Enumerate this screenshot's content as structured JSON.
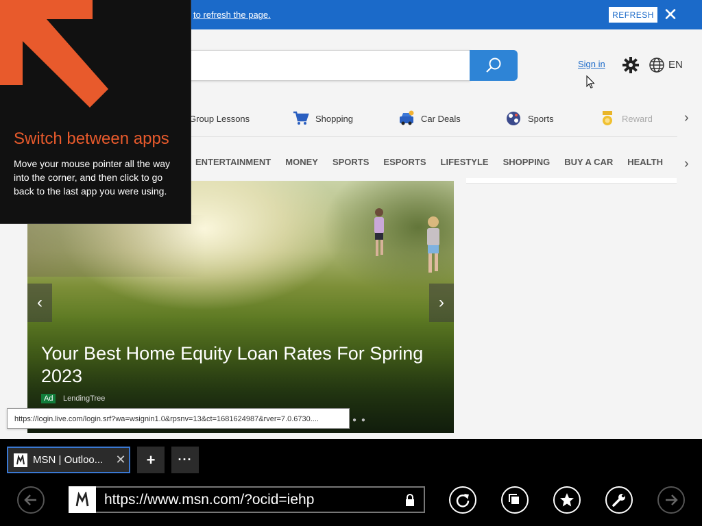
{
  "notification": {
    "text": "to refresh the page.",
    "refresh_label": "REFRESH",
    "close_glyph": "✕"
  },
  "header": {
    "search_placeholder": "",
    "signin_label": "Sign in",
    "language": "EN",
    "icons": [
      "search-icon",
      "gear-icon",
      "globe-icon"
    ]
  },
  "quick_links": [
    {
      "label": "Group Lessons",
      "icon": "none"
    },
    {
      "label": "Shopping",
      "icon": "cart-icon"
    },
    {
      "label": "Car Deals",
      "icon": "car-icon"
    },
    {
      "label": "Sports",
      "icon": "ball-icon"
    },
    {
      "label": "Reward",
      "icon": "medal-icon"
    }
  ],
  "nav_tabs": [
    "ENTERTAINMENT",
    "MONEY",
    "SPORTS",
    "ESPORTS",
    "LIFESTYLE",
    "SHOPPING",
    "BUY A CAR",
    "HEALTH"
  ],
  "hero": {
    "title": "Your Best Home Equity Loan Rates For Spring 2023",
    "ad_badge": "Ad",
    "source": "LendingTree",
    "dots": "● ●"
  },
  "status_url": "https://login.live.com/login.srf?wa=wsignin1.0&rpsnv=13&ct=1681624987&rver=7.0.6730....",
  "charm_tip": {
    "title": "Switch between apps",
    "body": "Move your mouse pointer all the way into the corner, and then click to go back to the last app you were using."
  },
  "browser": {
    "tab_title": "MSN | Outloo...",
    "tab_close": "✕",
    "new_tab": "+",
    "more": "···",
    "address": "https://www.msn.com/?ocid=iehp"
  },
  "colors": {
    "accent_blue": "#1b6ac9",
    "charm_orange": "#e85a2c",
    "ad_green": "#127d3b"
  }
}
